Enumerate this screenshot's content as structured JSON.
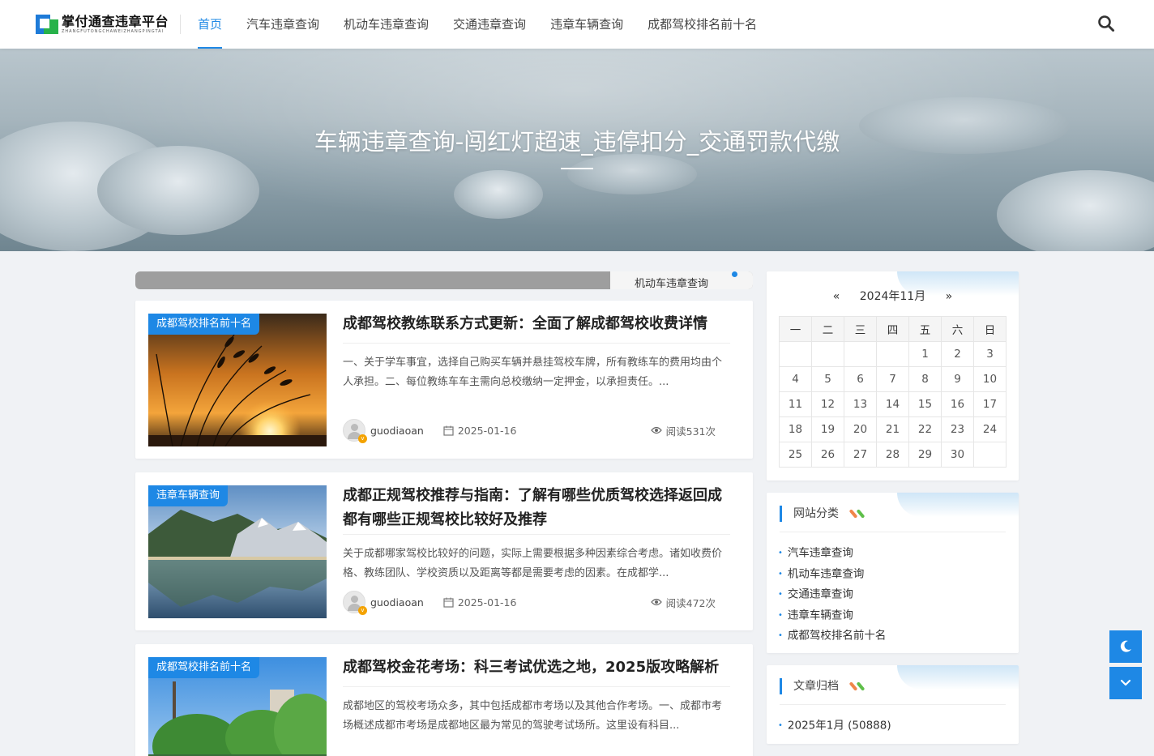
{
  "header": {
    "logo_title": "掌付通查违章平台",
    "logo_sub": "ZHANGFUTONGCHAWEIZHANGPINGTAI",
    "nav": [
      "首页",
      "汽车违章查询",
      "机动车违章查询",
      "交通违章查询",
      "违章车辆查询",
      "成都驾校排名前十名"
    ],
    "active_nav": "首页"
  },
  "banner": {
    "title": "车辆违章查询-闯红灯超速_违停扣分_交通罚款代缴"
  },
  "slider": {
    "image_alt": "机动车违章查询"
  },
  "posts": [
    {
      "tag": "成都驾校排名前十名",
      "title": "成都驾校教练联系方式更新：全面了解成都驾校收费详情",
      "excerpt": "一、关于学车事宜，选择自己购买车辆并悬挂驾校车牌，所有教练车的费用均由个人承担。二、每位教练车车主需向总校缴纳一定押金，以承担责任。...",
      "author": "guodiaoan",
      "date": "2025-01-16",
      "views": "阅读531次"
    },
    {
      "tag": "违章车辆查询",
      "title": "成都正规驾校推荐与指南：了解有哪些优质驾校选择返回成都有哪些正规驾校比较好及推荐",
      "excerpt": "关于成都哪家驾校比较好的问题，实际上需要根据多种因素综合考虑。诸如收费价格、教练团队、学校资质以及距离等都是需要考虑的因素。在成都学...",
      "author": "guodiaoan",
      "date": "2025-01-16",
      "views": "阅读472次"
    },
    {
      "tag": "成都驾校排名前十名",
      "title": "成都驾校金花考场：科三考试优选之地，2025版攻略解析",
      "excerpt": "成都地区的驾校考场众多，其中包括成都市考场以及其他合作考场。一、成都市考场概述成都市考场是成都地区最为常见的驾驶考试场所。这里设有科目...",
      "author": "",
      "date": "",
      "views": ""
    }
  ],
  "calendar": {
    "prev": "«",
    "next": "»",
    "month": "2024年11月",
    "weekdays": [
      "一",
      "二",
      "三",
      "四",
      "五",
      "六",
      "日"
    ],
    "weeks": [
      [
        "",
        "",
        "",
        "",
        "1",
        "2",
        "3"
      ],
      [
        "4",
        "5",
        "6",
        "7",
        "8",
        "9",
        "10"
      ],
      [
        "11",
        "12",
        "13",
        "14",
        "15",
        "16",
        "17"
      ],
      [
        "18",
        "19",
        "20",
        "21",
        "22",
        "23",
        "24"
      ],
      [
        "25",
        "26",
        "27",
        "28",
        "29",
        "30",
        ""
      ]
    ]
  },
  "categories": {
    "title": "网站分类",
    "items": [
      "汽车违章查询",
      "机动车违章查询",
      "交通违章查询",
      "违章车辆查询",
      "成都驾校排名前十名"
    ]
  },
  "archive": {
    "title": "文章归档",
    "items": [
      "2025年1月 (50888)"
    ]
  },
  "colors": {
    "accent": "#1e88e5",
    "dot_orange": "#f0864a",
    "dot_green": "#5fbf4a"
  }
}
